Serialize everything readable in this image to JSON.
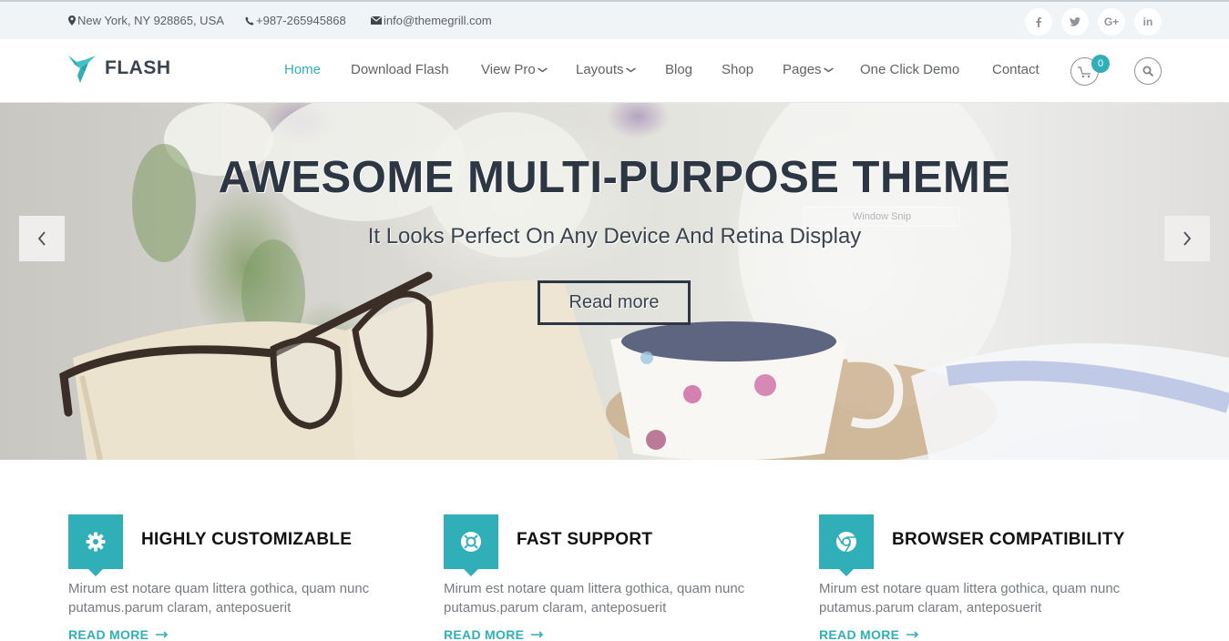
{
  "topbar": {
    "address": "New York, NY 928865, USA",
    "phone": "+987-265945868",
    "email": "info@themegrill.com",
    "social": [
      {
        "name": "facebook",
        "glyph": "f"
      },
      {
        "name": "twitter",
        "glyph": "t"
      },
      {
        "name": "google-plus",
        "glyph": "G+"
      },
      {
        "name": "linkedin",
        "glyph": "in"
      }
    ]
  },
  "header": {
    "logo_text": "FLASH",
    "nav": [
      {
        "label": "Home",
        "active": true,
        "dropdown": false
      },
      {
        "label": "Download Flash",
        "active": false,
        "dropdown": false
      },
      {
        "label": "View Pro",
        "active": false,
        "dropdown": true
      },
      {
        "label": "Layouts",
        "active": false,
        "dropdown": true
      },
      {
        "label": "Blog",
        "active": false,
        "dropdown": false
      },
      {
        "label": "Shop",
        "active": false,
        "dropdown": false
      },
      {
        "label": "Pages",
        "active": false,
        "dropdown": true
      },
      {
        "label": "One Click Demo",
        "active": false,
        "dropdown": false
      },
      {
        "label": "Contact",
        "active": false,
        "dropdown": false
      }
    ],
    "caret": "⌄",
    "cart_count": "0"
  },
  "hero": {
    "title": "AWESOME MULTI-PURPOSE THEME",
    "subtitle": "It Looks Perfect On Any Device And Retina Display",
    "button_label": "Read more",
    "overlay_label": "Window Snip"
  },
  "features": [
    {
      "icon": "gear-icon",
      "title": "HIGHLY CUSTOMIZABLE",
      "text": "Mirum est notare quam littera gothica, quam nunc putamus.parum claram, anteposuerit",
      "link": "READ MORE"
    },
    {
      "icon": "lifebuoy-icon",
      "title": "FAST SUPPORT",
      "text": "Mirum est notare quam littera gothica, quam nunc putamus.parum claram, anteposuerit",
      "link": "READ MORE"
    },
    {
      "icon": "chrome-icon",
      "title": "BROWSER COMPATIBILITY",
      "text": "Mirum est notare quam littera gothica, quam nunc putamus.parum claram, anteposuerit",
      "link": "READ MORE"
    }
  ],
  "colors": {
    "accent": "#30afb8",
    "heading_dark": "#2d3744",
    "topbar_bg": "#f1f4f6"
  }
}
